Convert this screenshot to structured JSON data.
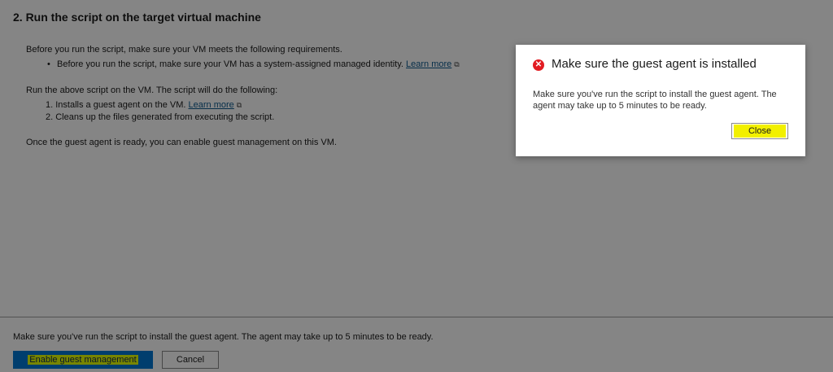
{
  "section": {
    "heading": "2. Run the script on the target virtual machine",
    "requirements_intro": "Before you run the script, make sure your VM meets the following requirements.",
    "requirement_bullet": "Before you run the script, make sure your VM has a system-assigned managed identity.",
    "learn_more": "Learn more",
    "steps_intro": "Run the above script on the VM. The script will do the following:",
    "steps": [
      "1. Installs a guest agent on the VM.",
      "2. Cleans up the files generated from executing the script."
    ],
    "outro": "Once the guest agent is ready, you can enable guest management on this VM."
  },
  "footer": {
    "note": "Make sure you've run the script to install the guest agent. The agent may take up to 5 minutes to be ready.",
    "enable_label": "Enable guest management",
    "cancel_label": "Cancel"
  },
  "dialog": {
    "icon": "error-circle-icon",
    "icon_glyph": "✕",
    "title": "Make sure the guest agent is installed",
    "body": "Make sure you've run the script to install the guest agent. The agent may take up to 5 minutes to be ready.",
    "close_label": "Close"
  },
  "colors": {
    "accent": "#0078d4",
    "error": "#e21c22",
    "highlight": "#e5ff00"
  }
}
